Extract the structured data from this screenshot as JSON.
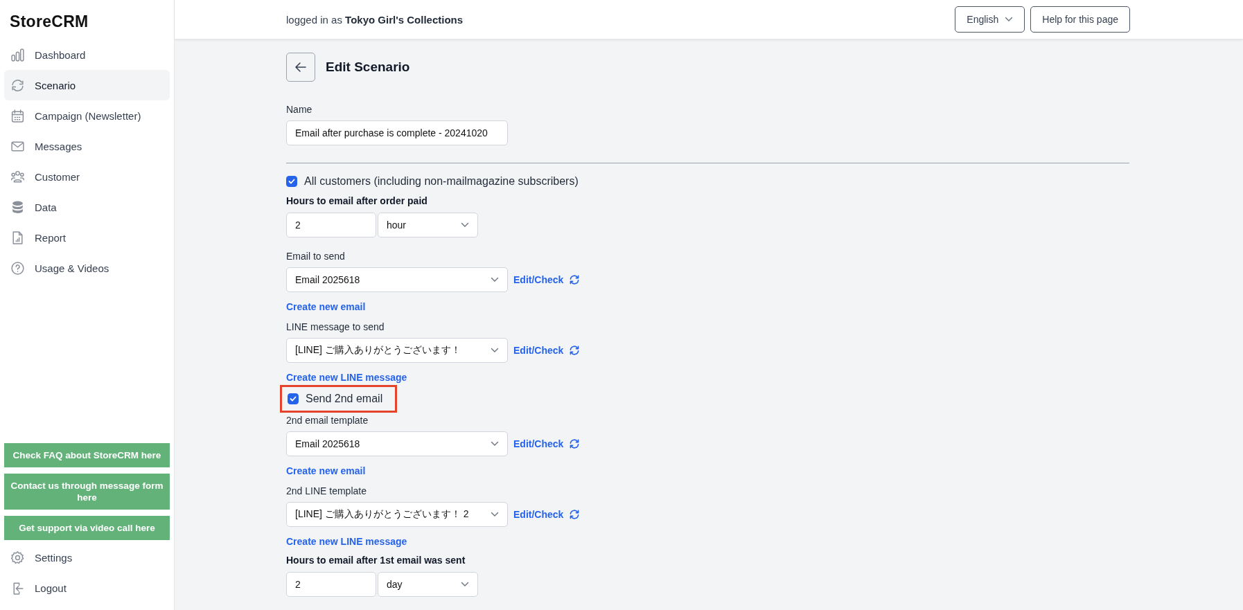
{
  "sidebar": {
    "logo": "StoreCRM",
    "items": [
      {
        "label": "Dashboard",
        "selected": false
      },
      {
        "label": "Scenario",
        "selected": true
      },
      {
        "label": "Campaign (Newsletter)",
        "selected": false
      },
      {
        "label": "Messages",
        "selected": false
      },
      {
        "label": "Customer",
        "selected": false
      },
      {
        "label": "Data",
        "selected": false
      },
      {
        "label": "Report",
        "selected": false
      },
      {
        "label": "Usage & Videos",
        "selected": false
      }
    ],
    "support_buttons": [
      "Check FAQ about StoreCRM here",
      "Contact us through message form here",
      "Get support via video call here"
    ],
    "bottom_items": [
      {
        "label": "Settings"
      },
      {
        "label": "Logout"
      }
    ]
  },
  "header": {
    "logged_in": "logged in as **Tokyo Girl's Collections**",
    "language": "English",
    "help": "Help for this page"
  },
  "page": {
    "title": "Edit Scenario"
  },
  "form": [
    {
      "kind": "text",
      "label": "Name",
      "value": "Email after purchase is complete - 20241020"
    },
    {
      "kind": "divider"
    },
    {
      "kind": "checkbox",
      "label": "All customers (including non-mailmagazine subscribers)",
      "checked": true,
      "highlighted": false
    },
    {
      "kind": "duration",
      "label": "Hours to email after order paid",
      "number": "2",
      "unit": "hour"
    },
    {
      "kind": "template",
      "label": "Email to send",
      "value": "Email 2025618",
      "action": "Edit/Check",
      "link": "Create new email"
    },
    {
      "kind": "template",
      "label": "LINE message to send",
      "value": "[LINE] ご購入ありがとうございます！",
      "action": "Edit/Check",
      "link": "Create new LINE message"
    },
    {
      "kind": "checkbox",
      "label": "Send 2nd email",
      "checked": true,
      "highlighted": true
    },
    {
      "kind": "template",
      "label": "2nd email template",
      "value": "Email 2025618",
      "action": "Edit/Check",
      "link": "Create new email"
    },
    {
      "kind": "template",
      "label": "2nd LINE template",
      "value": "[LINE] ご購入ありがとうございます！ 2",
      "action": "Edit/Check",
      "link": "Create new LINE message"
    },
    {
      "kind": "duration",
      "label": "Hours to email after 1st email was sent",
      "number": "2",
      "unit": "day"
    }
  ]
}
